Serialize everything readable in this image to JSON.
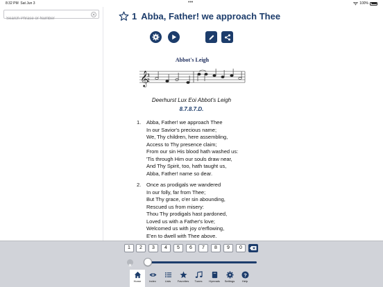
{
  "status_bar": {
    "time": "8:32 PM",
    "date": "Sat Jun 3",
    "battery": "100%",
    "dots": "•••"
  },
  "search": {
    "placeholder": "Search Phrase or Number",
    "value": ""
  },
  "hymn": {
    "number": "1",
    "title": "Abba, Father! we approach Thee",
    "tune_name": "Abbot's Leigh",
    "tunes": "Deerhurst Lux Eoi Abbot's Leigh",
    "meter": "8.7.8.7.D.",
    "verses": [
      {
        "num": "1.",
        "lines": [
          "Abba, Father! we approach Thee",
          "In our Savior's precious name;",
          "We, Thy children, here assembling,",
          "Access to Thy presence claim;",
          "From our sin His blood hath washed us:",
          "'Tis through Him our souls draw near,",
          "And Thy Spirit, too, hath taught us,",
          "Abba, Father! name so dear."
        ]
      },
      {
        "num": "2.",
        "lines": [
          "Once as prodigals we wandered",
          "In our folly, far from Thee;",
          "But Thy grace, o'er sin abounding,",
          "Rescued us from misery:",
          "Thou Thy prodigals hast pardoned,",
          "Loved us with a Father's love;",
          "Welcomed us with joy o'erflowing,",
          "E'en to dwell with Thee above."
        ]
      }
    ]
  },
  "numpad": {
    "keys": [
      "1",
      "2",
      "3",
      "4",
      "5",
      "6",
      "7",
      "8",
      "9",
      "0"
    ]
  },
  "slider": {
    "value": 0
  },
  "tabs": [
    {
      "label": "Home",
      "icon": "home-icon"
    },
    {
      "label": "Index",
      "icon": "eye-icon"
    },
    {
      "label": "Lists",
      "icon": "list-icon"
    },
    {
      "label": "Favorites",
      "icon": "star-icon"
    },
    {
      "label": "Tunes",
      "icon": "music-note-icon"
    },
    {
      "label": "Hymnals",
      "icon": "book-icon"
    },
    {
      "label": "Settings",
      "icon": "gear-icon"
    },
    {
      "label": "Help",
      "icon": "help-icon"
    }
  ],
  "colors": {
    "accent": "#1c3c6b",
    "toolbar": "#d1d3d9"
  }
}
